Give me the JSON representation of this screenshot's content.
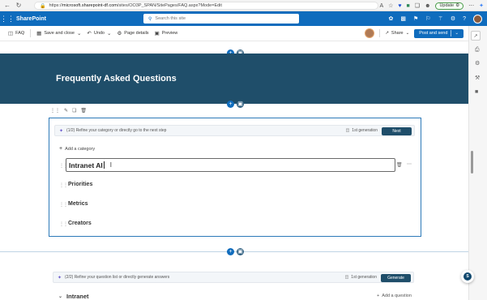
{
  "browser": {
    "url_prefix": "https://",
    "url_host": "microsoft.sharepoint-df.com",
    "url_path": "/sites/OO3P_SPAN/SitePages/FAQ.aspx?Mode=Edit",
    "update_label": "Update"
  },
  "suite": {
    "app_name": "SharePoint",
    "search_placeholder": "Search this site"
  },
  "command_bar": {
    "page_name": "FAQ",
    "save_close": "Save and close",
    "undo": "Undo",
    "page_details": "Page details",
    "preview": "Preview",
    "share": "Share",
    "post": "Post and send"
  },
  "hero": {
    "title": "Frequently Asked Questions"
  },
  "faq_webpart": {
    "prompt_text": "(1/2) Refine your category or directly go to the next step",
    "generation_label": "1st generation",
    "next_button": "Next",
    "add_category": "Add a category",
    "editing_value": "Intranet AI",
    "categories": [
      "Priorities",
      "Metrics",
      "Creators"
    ]
  },
  "question_webpart": {
    "prompt_text": "(2/2) Refine your question list or directly generate answers",
    "generation_label": "1st generation",
    "generate_button": "Generate",
    "category_name": "Intranet",
    "add_question": "Add a question"
  },
  "colors": {
    "brand_blue": "#0f6cbd",
    "hero_bg": "#1f4e6a",
    "selection_border": "#2d7ab9"
  },
  "icons": [
    "back-icon",
    "refresh-icon",
    "lock-icon",
    "star-icon",
    "waffle-icon",
    "search-icon",
    "settings-icon",
    "help-icon",
    "trash-icon",
    "more-icon",
    "sparkle-icon",
    "drag-handle-icon",
    "plus-icon",
    "chevron-down-icon",
    "copilot-icon"
  ]
}
